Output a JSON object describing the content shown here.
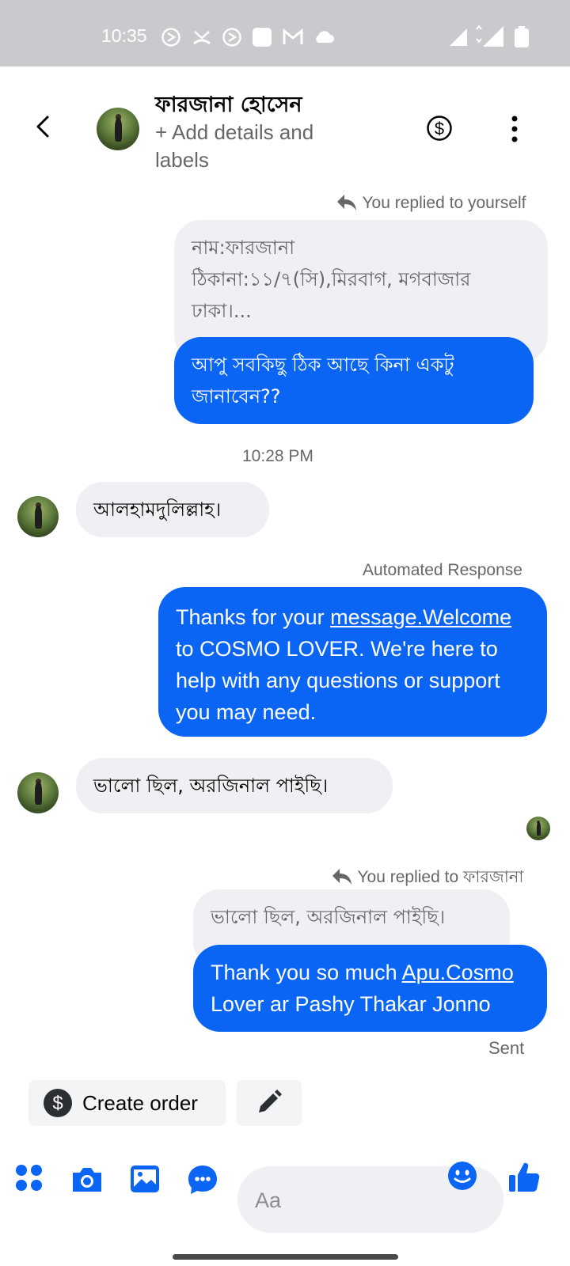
{
  "status_bar": {
    "time": "10:35",
    "network": "4G",
    "icons": [
      "sync-icon",
      "missed-call-icon",
      "sync-icon",
      "app-icon",
      "gmail-icon",
      "cloud-icon",
      "signal-icon",
      "signal-4g-icon",
      "battery-icon"
    ]
  },
  "header": {
    "name": "ফারজানা হোসেন",
    "subtitle": "+ Add details and labels",
    "icons": [
      "back-icon",
      "avatar",
      "dollar-icon",
      "more-icon"
    ]
  },
  "messages": {
    "reply1_meta": "You replied to yourself",
    "reply1_quoted_lines": [
      "নাম:ফারজানা",
      "ঠিকানা:১১/৭(সি),মিরবাগ, মগবাজার",
      "ঢাকা।..."
    ],
    "reply1_text_lines": [
      "আপু সবকিছু ঠিক আছে কিনা একটু",
      "জানাবেন??"
    ],
    "timestamp": "10:28 PM",
    "incoming1": "আলহামদুলিল্লাহ।",
    "auto_meta": "Automated Response",
    "auto_lines_1a": "Thanks for your ",
    "auto_lines_1b": "message.Welcome",
    "auto_lines_2": "to COSMO LOVER. We're here to",
    "auto_lines_3": "help with any questions or support",
    "auto_lines_4": "you may need.",
    "incoming2": "ভালো ছিল, অরজিনাল পাইছি।",
    "reply2_meta_prefix": "You replied to ",
    "reply2_meta_name": "ফারজানা",
    "reply2_quoted": "ভালো ছিল, অরজিনাল পাইছি।",
    "reply2_line1a": "Thank you so much ",
    "reply2_line1b": "Apu.Cosmo",
    "reply2_line2": "Lover ar Pashy Thakar Jonno",
    "sent_status": "Sent"
  },
  "actions": {
    "create_order": "Create order"
  },
  "composer": {
    "placeholder": "Aa",
    "icons": [
      "apps-icon",
      "camera-icon",
      "gallery-icon",
      "chat-icon",
      "emoji-icon",
      "like-icon"
    ]
  },
  "colors": {
    "accent": "#0a65f5",
    "bubble_gray": "#f0f0f4",
    "status_bar": "#c8cacd"
  }
}
